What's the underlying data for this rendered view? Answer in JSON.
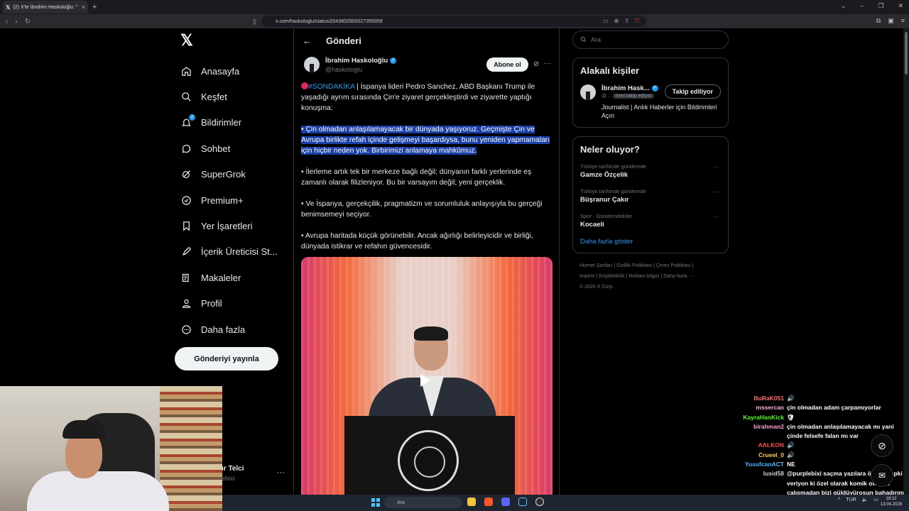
{
  "browser": {
    "tab_title": "(2) X'te İbrahim Haskoloğlu: \"",
    "url": "x.com/haskologlu/status/2043602900027359359",
    "new_tab": "+"
  },
  "nav": {
    "items": [
      {
        "label": "Anasayfa",
        "icon": "home-icon"
      },
      {
        "label": "Keşfet",
        "icon": "search-icon"
      },
      {
        "label": "Bildirimler",
        "icon": "bell-icon",
        "badge": "2"
      },
      {
        "label": "Sohbet",
        "icon": "chat-icon"
      },
      {
        "label": "SuperGrok",
        "icon": "grok-icon"
      },
      {
        "label": "Premium+",
        "icon": "premium-icon"
      },
      {
        "label": "Yer İşaretleri",
        "icon": "bookmark-icon"
      },
      {
        "label": "İçerik Üreticisi St...",
        "icon": "rocket-icon"
      },
      {
        "label": "Makaleler",
        "icon": "article-icon"
      },
      {
        "label": "Profil",
        "icon": "profile-icon"
      },
      {
        "label": "Daha fazla",
        "icon": "more-circle-icon"
      }
    ],
    "post_button": "Gönderiyi yayınla",
    "account_name": "ır Telci",
    "account_handle": "ebixi"
  },
  "main": {
    "header_title": "Gönderi",
    "author_name": "İbrahim Haskoloğlu",
    "author_handle": "@haskologlu",
    "subscribe_label": "Abone ol",
    "tweet": {
      "hashtag": "#SONDAKİKA",
      "intro": " | İspanya lideri Pedro Sanchez, ABD Başkanı Trump ile yaşadığı ayrım sırasında Çin'e ziyaret gerçekleştirdi ve ziyarette yaptığı konuşma:",
      "p1": "• Çin olmadan anlaşılamayacak bir dünyada yaşıyoruz. Geçmişte Çin ve Avrupa birlikte refah içinde gelişmeyi başardıysa, bunu yeniden yapmamaları için hiçbir neden yok. Birbirimizi anlamaya mahkûmuz.",
      "p2": "• İlerleme artık tek bir merkeze bağlı değil; dünyanın farklı yerlerinde eş zamanlı olarak filizleniyor. Bu bir varsayım değil; yeni gerçeklik.",
      "p3": "• Ve İspanya, gerçekçilik, pragmatizm ve sorumluluk anlayışıyla bu gerçeği benimsemeyi seçiyor.",
      "p4": "• Avrupa haritada küçük görünebilir. Ancak ağırlığı belirleyicidir ve birliği, dünyada istikrar ve refahın güvencesidir."
    }
  },
  "right": {
    "search_placeholder": "Ara",
    "related_title": "Alakalı kişiler",
    "related": {
      "name": "İbrahim Hask...",
      "handle": "@...",
      "follows_you": "Seni takip ediyor",
      "button": "Takip ediliyor",
      "bio": "Journalist | Anlık Haberler için Bildirimleri Açın"
    },
    "trends_title": "Neler oluyor?",
    "trends": [
      {
        "context": "Türkiye tarihinde gündemde",
        "name": "Gamze Özçelik"
      },
      {
        "context": "Türkiye tarihinde gündemde",
        "name": "Büşranur Çakır"
      },
      {
        "context": "Spor · Gündemdekiler",
        "name": "Kocaeli"
      }
    ],
    "show_more": "Daha fazla göster",
    "footer_line1": "Hizmet Şartları  |  Gizlilik Politikası  |  Çerez Politikası  |",
    "footer_line2": "Imprint  |  Erişilebilirlik  |  Reklam bilgisi  |  Daha fazla ···",
    "footer_line3": "© 2026 X Corp."
  },
  "chat": [
    {
      "user": "BuRaK051",
      "color": "#ff6b6b",
      "msg": "🔊"
    },
    {
      "user": "mssercan",
      "color": "#ffb3d9",
      "msg": "çin olmadan adam çarpamıyorlar"
    },
    {
      "user": "KayraHanKick",
      "color": "#53fc18",
      "msg": "🛡"
    },
    {
      "user": "birahman2",
      "color": "#ff9fd6",
      "msg": "çin olmadan anlaşılamayacak mı yani çinde felsefe falan mı var"
    },
    {
      "user": "AALKON",
      "color": "#ff4b4b",
      "msg": "🔊"
    },
    {
      "user": "Crueel_0",
      "color": "#ffd24b",
      "msg": "🔊"
    },
    {
      "user": "YusufcanACT",
      "color": "#4bb3ff",
      "msg": "NE"
    },
    {
      "user": "lusid58",
      "color": "#cfcfcf",
      "msg": "@purplebixi saçma yazılara öyle bi tepki veriyon ki özel olarak komik olmaya çalışmadan bizi güldüyürosun bahadırım adamsın"
    }
  ],
  "taskbar": {
    "search": "Ara",
    "lang": "TUR",
    "time": "18:12",
    "date": "13.04.2026"
  }
}
